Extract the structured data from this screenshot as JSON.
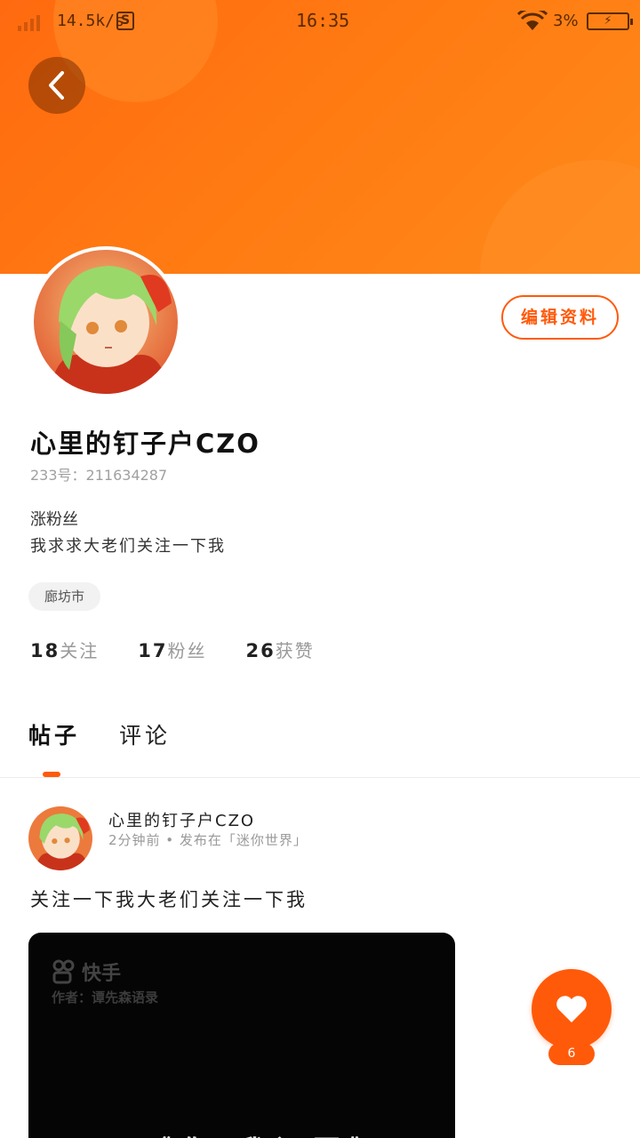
{
  "colors": {
    "accent": "#ff5a0a",
    "header_gradient_start": "#ff6a10",
    "header_gradient_end": "#ff8a1a"
  },
  "status_bar": {
    "network_speed": "14.5k/s",
    "s_icon_label": "S",
    "time": "16:35",
    "battery_percent": "3%",
    "battery_icon": "charging-battery-icon"
  },
  "header": {
    "back_icon": "chevron-left-icon"
  },
  "profile": {
    "edit_label": "编辑资料",
    "username": "心里的钉子户CZO",
    "id_text": "233号：211634287",
    "bio_line1": "涨粉丝",
    "bio_line2": "我求求大老们关注一下我",
    "location": "廊坊市",
    "stats": {
      "following_count": "18",
      "following_label": "关注",
      "fans_count": "17",
      "fans_label": "粉丝",
      "likes_count": "26",
      "likes_label": "获赞"
    }
  },
  "tabs": [
    {
      "label": "帖子",
      "active": true
    },
    {
      "label": "评论",
      "active": false
    }
  ],
  "post": {
    "author": "心里的钉子户CZO",
    "meta": "2分钟前 • 发布在「迷你世界」",
    "text": "关注一下我大老们关注一下我",
    "video": {
      "logo_text": "快手",
      "author_line": "作者：谭先森语录",
      "caption": "《你    我还要》"
    }
  },
  "like_button": {
    "icon": "heart-icon",
    "count": "6"
  }
}
